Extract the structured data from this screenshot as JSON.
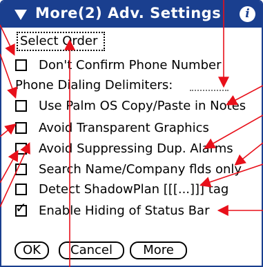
{
  "dialog": {
    "title": "More(2) Adv. Settings",
    "info_glyph": "i",
    "menu_triangle_icon": "dropdown-triangle-icon"
  },
  "select_order": {
    "label": "Select Order"
  },
  "options": [
    {
      "label": "Don't Confirm Phone Number",
      "checked": false
    },
    {
      "label": "Use Palm OS Copy/Paste in Notes",
      "checked": false
    },
    {
      "label": "Avoid Transparent Graphics",
      "checked": false
    },
    {
      "label": "Avoid Suppressing Dup. Alarms",
      "checked": false
    },
    {
      "label": "Search Name/Company flds only",
      "checked": false
    },
    {
      "label": "Detect ShadowPlan [[[...]]] tag",
      "checked": false
    },
    {
      "label": "Enable Hiding of Status Bar",
      "checked": true
    }
  ],
  "delimiters": {
    "label": "Phone Dialing Delimiters:",
    "value": ""
  },
  "buttons": {
    "ok": "OK",
    "cancel": "Cancel",
    "more": "More"
  },
  "colors": {
    "title_bar": "#1a3f8f",
    "annotation_arrow": "#e8101a"
  }
}
